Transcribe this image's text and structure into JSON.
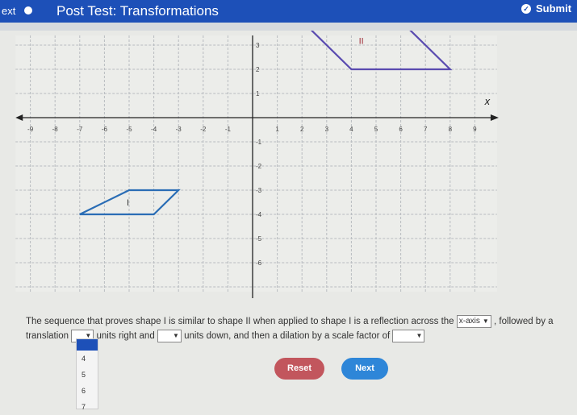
{
  "header": {
    "prev_label": "ext",
    "title": "Post Test: Transformations",
    "submit_label": "Submit"
  },
  "graph": {
    "axis_label_x": "x",
    "x_ticks": [
      "-9",
      "-8",
      "-7",
      "-6",
      "-5",
      "-4",
      "-3",
      "-2",
      "-1",
      "1",
      "2",
      "3",
      "4",
      "5",
      "6",
      "7",
      "8",
      "9"
    ],
    "y_ticks": [
      "3",
      "2",
      "1",
      "-1",
      "-2",
      "-3",
      "-4",
      "-5",
      "-6"
    ],
    "x_range": [
      -9.6,
      10
    ],
    "y_range": [
      -7.2,
      3.4
    ],
    "shapes": [
      {
        "label": "I",
        "color": "#2a6db5",
        "points": [
          [
            -5,
            -3
          ],
          [
            -3,
            -3
          ],
          [
            -4,
            -4
          ],
          [
            -7,
            -4
          ]
        ]
      },
      {
        "label": "II",
        "color": "#5a4bb0",
        "label_color": "#a0303a",
        "points": [
          [
            2,
            4
          ],
          [
            4,
            2
          ],
          [
            8,
            2
          ],
          [
            6,
            4
          ]
        ]
      }
    ]
  },
  "question": {
    "part1": "The sequence that proves shape I is similar to shape II when applied to shape I is a reflection across the",
    "select1": "x-axis",
    "part2": ", followed by a",
    "part3": "translation",
    "select2": "",
    "part4": "units right and",
    "select3": "",
    "part5": "units down, and then a dilation by a scale factor of",
    "select4": "",
    "dropdown_options": [
      "4",
      "5",
      "6",
      "7"
    ]
  },
  "buttons": {
    "reset": "Reset",
    "next": "Next"
  }
}
